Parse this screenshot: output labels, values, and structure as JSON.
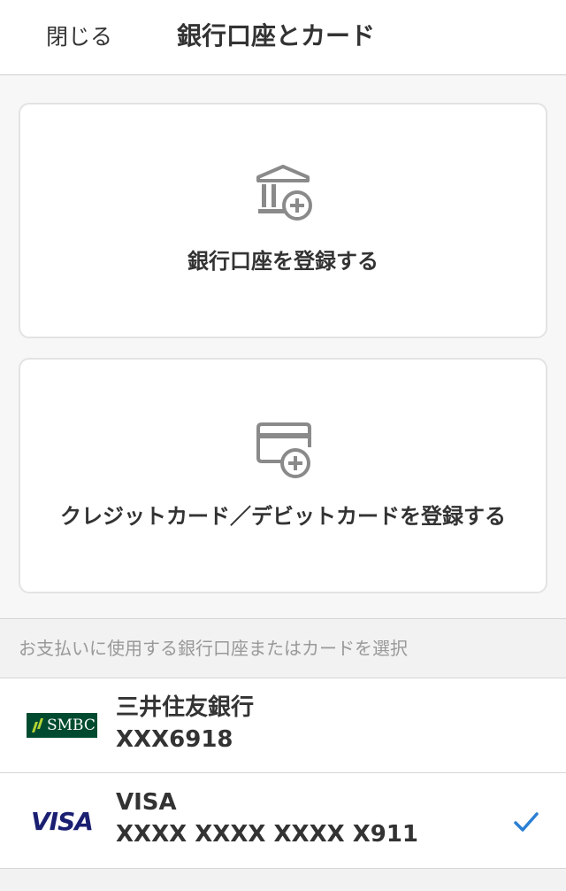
{
  "header": {
    "close_label": "閉じる",
    "title": "銀行口座とカード"
  },
  "add_options": [
    {
      "label": "銀行口座を登録する",
      "icon": "bank-add-icon"
    },
    {
      "label": "クレジットカード／デビットカードを登録する",
      "icon": "card-add-icon"
    }
  ],
  "section": {
    "label": "お支払いに使用する銀行口座またはカードを選択"
  },
  "payment_methods": [
    {
      "name": "三井住友銀行",
      "number": "XXX6918",
      "logo": "SMBC",
      "logo_color": "#004b2f",
      "selected": false
    },
    {
      "name": "VISA",
      "number": "XXXX XXXX XXXX X911",
      "logo": "VISA",
      "logo_color": "#1a1f71",
      "selected": true
    }
  ],
  "colors": {
    "accent": "#2a7fd4",
    "text": "#333333",
    "icon_gray": "#8a8a8a",
    "muted_text": "#999999"
  }
}
